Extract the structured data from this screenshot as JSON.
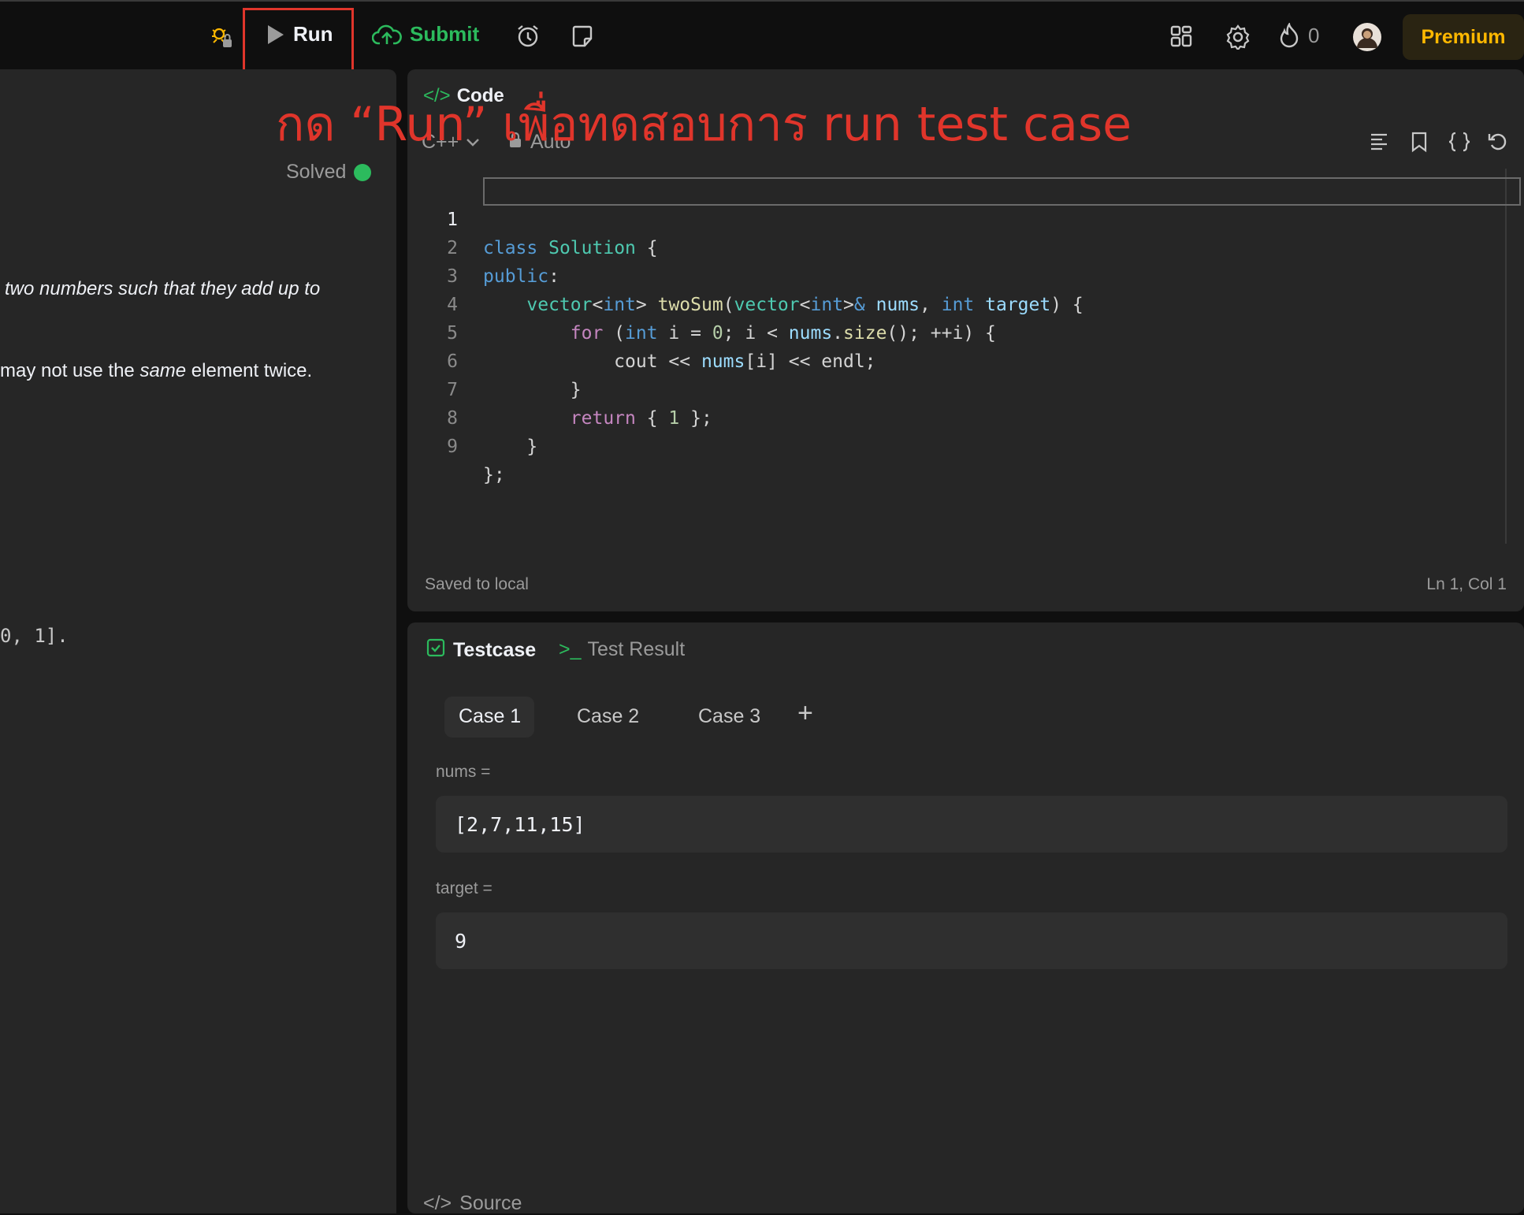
{
  "topbar": {
    "run_label": "Run",
    "submit_label": "Submit",
    "streak_count": "0",
    "premium_label": "Premium"
  },
  "left": {
    "solved_label": "Solved",
    "desc_line1": "two numbers such that they add up to",
    "desc_line2_pre": "may not use the ",
    "desc_line2_em": "same",
    "desc_line2_post": " element twice.",
    "example_fragment": "0, 1]."
  },
  "editor": {
    "tab_label": "Code",
    "language": "C++",
    "mode": "Auto",
    "status_left": "Saved to local",
    "status_right": "Ln 1, Col 1",
    "line_numbers": [
      "1",
      "2",
      "3",
      "4",
      "5",
      "6",
      "7",
      "8",
      "9"
    ]
  },
  "annotation": {
    "text": "กด “Run” เพื่อทดสอบการ run test case"
  },
  "tests": {
    "tab_testcase": "Testcase",
    "tab_result": "Test Result",
    "cases": [
      "Case 1",
      "Case 2",
      "Case 3"
    ],
    "add": "+",
    "nums_label": "nums =",
    "nums_value": "[2,7,11,15]",
    "target_label": "target =",
    "target_value": "9",
    "source_label": "Source"
  },
  "colors": {
    "accent_green": "#2cbb5d",
    "premium": "#ffb800",
    "annotation_red": "#e0352b"
  }
}
